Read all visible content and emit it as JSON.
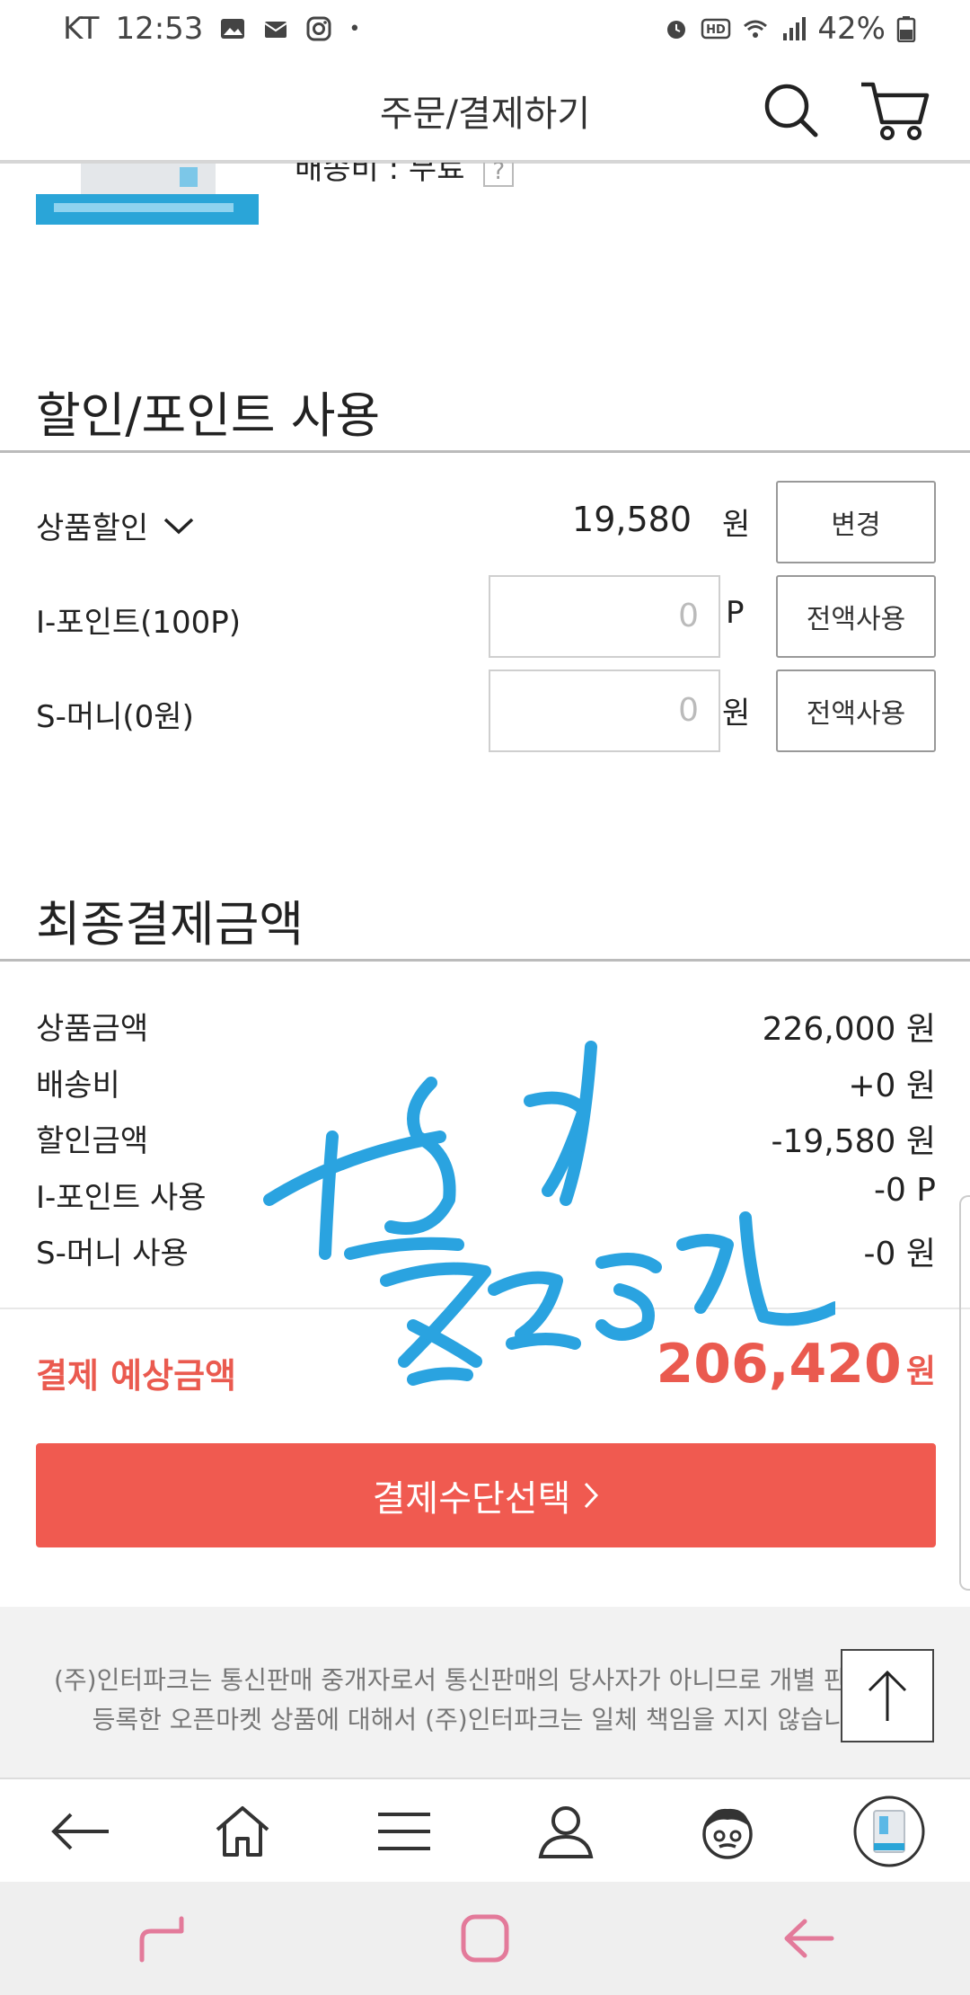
{
  "status_bar": {
    "carrier": "KT",
    "time": "12:53",
    "battery": "42%"
  },
  "header": {
    "title": "주문/결제하기",
    "icons": [
      "search-icon",
      "cart-icon"
    ]
  },
  "product": {
    "shipping_text": "배송비 : 무료",
    "help_mark": "?"
  },
  "discount_section": {
    "title": "할인/포인트 사용",
    "product_discount": {
      "label": "상품할인",
      "value": "19,580",
      "unit": "원",
      "button": "변경"
    },
    "ipoint": {
      "label": "I-포인트(100P)",
      "input_value": "0",
      "unit": "P",
      "button": "전액사용"
    },
    "smoney": {
      "label": "S-머니(0원)",
      "input_value": "0",
      "unit": "원",
      "button": "전액사용"
    }
  },
  "final_section": {
    "title": "최종결제금액",
    "rows": [
      {
        "label": "상품금액",
        "value": "226,000 원"
      },
      {
        "label": "배송비",
        "value": "+0 원"
      },
      {
        "label": "할인금액",
        "value": "-19,580 원"
      },
      {
        "label": "I-포인트 사용",
        "value": "-0 P"
      },
      {
        "label": "S-머니 사용",
        "value": "-0 원"
      }
    ],
    "expected_label": "결제 예상금액",
    "expected_value": "206,420",
    "expected_unit": "원"
  },
  "pay_button": {
    "label": "결제수단선택",
    "arrow": ">"
  },
  "footer": {
    "notice": "(주)인터파크는 통신판매 중개자로서 통신판매의 당사자가 아니므로 개별 판매자가 등록한 오픈마켓 상품에 대해서 (주)인터파크는 일체 책임을 지지 않습니다."
  },
  "bottom_nav": {
    "items": [
      "back-icon",
      "home-icon",
      "menu-icon",
      "user-icon",
      "character-icon",
      "recent-product-icon"
    ]
  },
  "system_nav": {
    "items": [
      "recents-icon",
      "home-button-icon",
      "system-back-icon"
    ]
  },
  "colors": {
    "accent": "#f05a50",
    "accent_text": "#ea5a4f",
    "handwriting": "#2aa3e0",
    "system_nav_icon": "#e37a9a"
  }
}
